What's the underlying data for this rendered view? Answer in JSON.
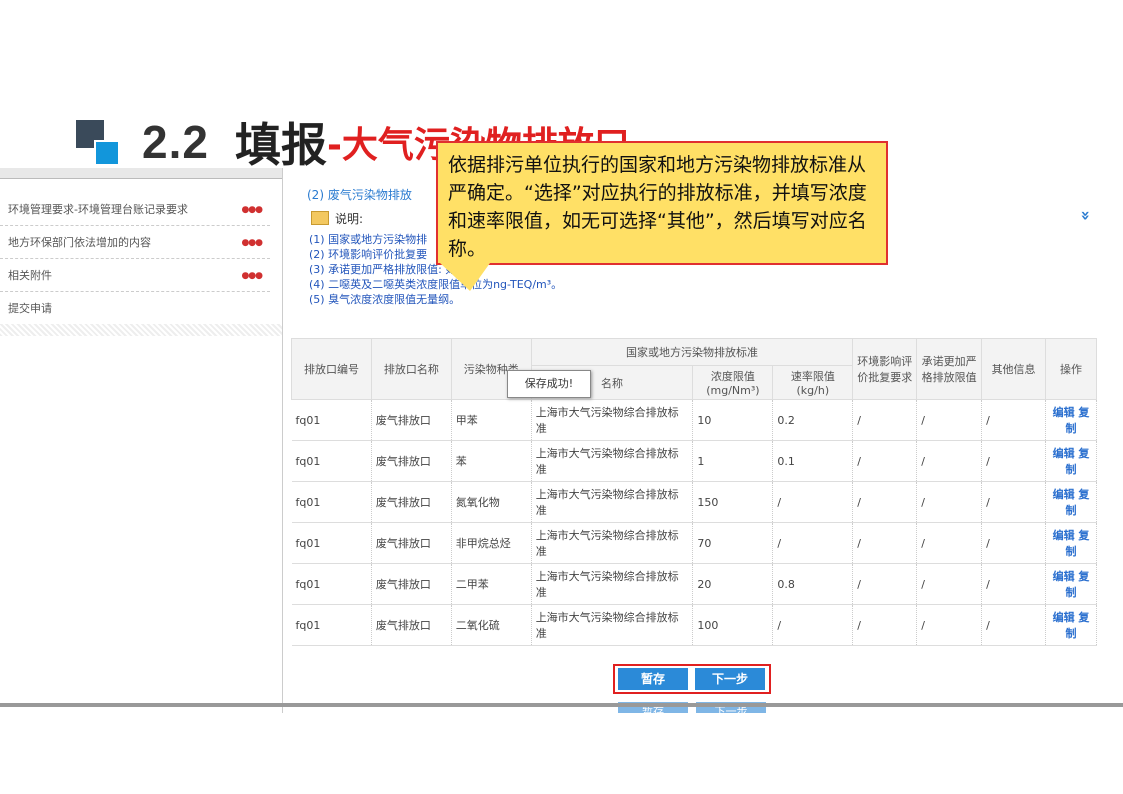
{
  "slide": {
    "number": "2.2",
    "title": "填报",
    "subtitle": "-大气污染物排放口"
  },
  "callout": {
    "text": "依据排污单位执行的国家和地方污染物排放标准从严确定。“选择”对应执行的排放标准，并填写浓度和速率限值，如无可选择“其他”，然后填写对应名称。"
  },
  "sidebar": {
    "items": [
      {
        "label": "环境管理要求-环境管理台账记录要求"
      },
      {
        "label": "地方环保部门依法增加的内容"
      },
      {
        "label": "相关附件"
      },
      {
        "label": "提交申请"
      }
    ]
  },
  "main": {
    "section_title": "(2) 废气污染物排放",
    "note_label": "说明:",
    "notes": [
      "(1) 国家或地方污染物排",
      "(2) 环境影响评价批复要",
      "(3) 承诺更加严格排放限值: 如",
      "(4) 二噁英及二噁英类浓度限值单位为ng-TEQ/m³。",
      "(5) 臭气浓度浓度限值无量纲。"
    ],
    "toast": "保存成功!"
  },
  "table": {
    "group_header": "国家或地方污染物排放标准",
    "headers": {
      "outlet_id": "排放口编号",
      "outlet_name": "排放口名称",
      "pollutant": "污染物种类",
      "standard_name": "名称",
      "conc_limit": "浓度限值",
      "conc_unit": "(mg/Nm³)",
      "rate_limit": "速率限值",
      "rate_unit": "(kg/h)",
      "eia": "环境影响评价批复要求",
      "stricter": "承诺更加严格排放限值",
      "other": "其他信息",
      "ops": "操作"
    },
    "rows": [
      {
        "outlet_id": "fq01",
        "outlet_name": "废气排放口",
        "pollutant": "甲苯",
        "standard": "上海市大气污染物综合排放标准",
        "conc": "10",
        "rate": "0.2",
        "eia": "/",
        "stricter": "/",
        "other": "/",
        "ops": "编辑 复制"
      },
      {
        "outlet_id": "fq01",
        "outlet_name": "废气排放口",
        "pollutant": "苯",
        "standard": "上海市大气污染物综合排放标准",
        "conc": "1",
        "rate": "0.1",
        "eia": "/",
        "stricter": "/",
        "other": "/",
        "ops": "编辑 复制"
      },
      {
        "outlet_id": "fq01",
        "outlet_name": "废气排放口",
        "pollutant": "氮氧化物",
        "standard": "上海市大气污染物综合排放标准",
        "conc": "150",
        "rate": "/",
        "eia": "/",
        "stricter": "/",
        "other": "/",
        "ops": "编辑 复制"
      },
      {
        "outlet_id": "fq01",
        "outlet_name": "废气排放口",
        "pollutant": "非甲烷总烃",
        "standard": "上海市大气污染物综合排放标准",
        "conc": "70",
        "rate": "/",
        "eia": "/",
        "stricter": "/",
        "other": "/",
        "ops": "编辑 复制"
      },
      {
        "outlet_id": "fq01",
        "outlet_name": "废气排放口",
        "pollutant": "二甲苯",
        "standard": "上海市大气污染物综合排放标准",
        "conc": "20",
        "rate": "0.8",
        "eia": "/",
        "stricter": "/",
        "other": "/",
        "ops": "编辑 复制"
      },
      {
        "outlet_id": "fq01",
        "outlet_name": "废气排放口",
        "pollutant": "二氧化硫",
        "standard": "上海市大气污染物综合排放标准",
        "conc": "100",
        "rate": "/",
        "eia": "/",
        "stricter": "/",
        "other": "/",
        "ops": "编辑 复制"
      }
    ]
  },
  "buttons": {
    "save": "暂存",
    "next": "下一步"
  },
  "colors": {
    "accent_red": "#e02020",
    "callout_bg": "#ffe066",
    "button_blue": "#2b8ad8",
    "link_blue": "#2a7bd0"
  }
}
